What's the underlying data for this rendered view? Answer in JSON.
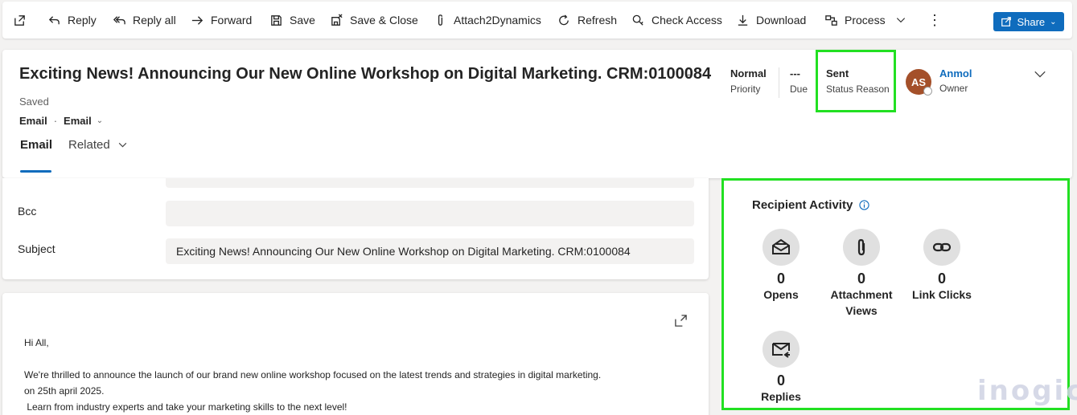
{
  "toolbar": {
    "items": [
      {
        "icon": "popout-icon",
        "label": ""
      },
      {
        "icon": "reply-icon",
        "label": "Reply"
      },
      {
        "icon": "reply-all-icon",
        "label": "Reply all"
      },
      {
        "icon": "forward-icon",
        "label": "Forward"
      },
      {
        "icon": "save-icon",
        "label": "Save"
      },
      {
        "icon": "save-close-icon",
        "label": "Save & Close"
      },
      {
        "icon": "paperclip-icon",
        "label": "Attach2Dynamics"
      },
      {
        "icon": "refresh-icon",
        "label": "Refresh"
      },
      {
        "icon": "check-access-icon",
        "label": "Check Access"
      },
      {
        "icon": "download-icon",
        "label": "Download"
      },
      {
        "icon": "process-icon",
        "label": "Process"
      }
    ],
    "share_label": "Share",
    "accent": "#0f6cbd"
  },
  "header": {
    "title": "Exciting News! Announcing Our New Online Workshop on Digital Marketing. CRM:0100084",
    "title_suffix": "-",
    "save_status": "Saved",
    "entity": "Email",
    "form": "Email",
    "tabs": [
      "Email",
      "Related"
    ],
    "fields": {
      "priority": {
        "value": "Normal",
        "label": "Priority"
      },
      "due": {
        "value": "---",
        "label": "Due"
      },
      "status": {
        "value": "Sent",
        "label": "Status Reason"
      }
    },
    "owner": {
      "initials": "AS",
      "name": "Anmol",
      "label": "Owner",
      "avatar_color": "#a4502a"
    }
  },
  "form": {
    "bcc": {
      "label": "Bcc",
      "value": ""
    },
    "subject": {
      "label": "Subject",
      "value": "Exciting News! Announcing Our New Online Workshop on Digital Marketing. CRM:0100084"
    }
  },
  "body": {
    "lines": [
      "Hi All,",
      "We're thrilled to announce the launch of our brand new online workshop focused on the latest trends and strategies in digital marketing.",
      "on 25th april 2025.",
      " Learn from industry experts and take your marketing skills to the next level!"
    ]
  },
  "activity": {
    "title": "Recipient Activity",
    "metrics": [
      {
        "icon": "open-envelope-icon",
        "value": "0",
        "label": "Opens"
      },
      {
        "icon": "attachment-icon",
        "value": "0",
        "label": "Attachment Views"
      },
      {
        "icon": "link-icon",
        "value": "0",
        "label": "Link Clicks"
      },
      {
        "icon": "reply-envelope-icon",
        "value": "0",
        "label": "Replies"
      }
    ],
    "highlight_color": "#22e022"
  },
  "watermark": "inogic"
}
